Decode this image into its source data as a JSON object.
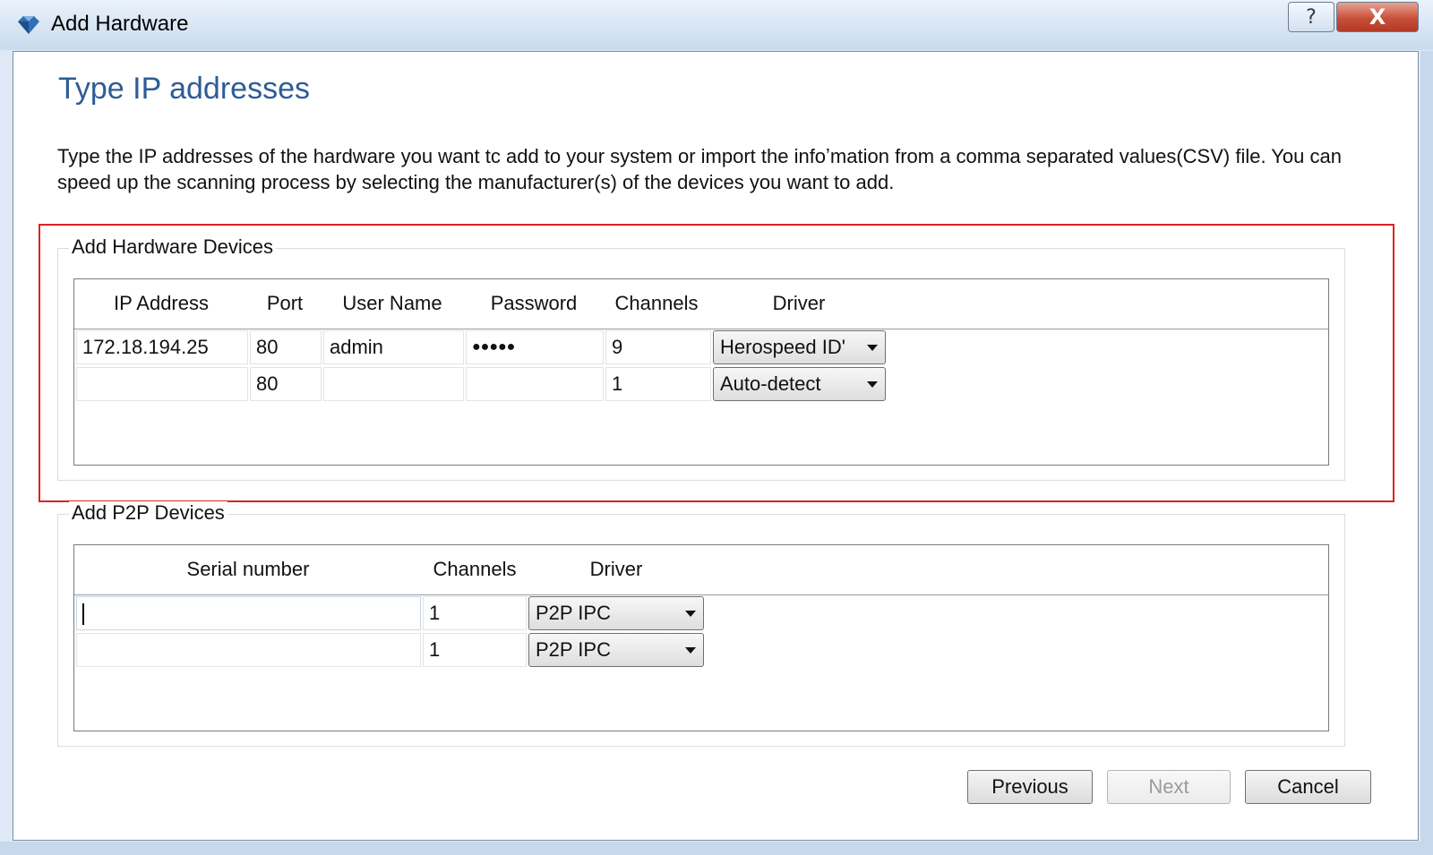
{
  "window": {
    "title": "Add Hardware",
    "help_label": "?",
    "close_label": "X"
  },
  "page": {
    "heading": "Type IP addresses",
    "description": "Type the IP addresses of the hardware you want tc add to your system or import the infoʼmation from a comma separated values(CSV) file. You can speed up the scanning process by selecting the manufacturer(s) of the devices you want to add."
  },
  "hardware_group": {
    "legend": "Add Hardware Devices",
    "headers": {
      "ip": "IP Address",
      "port": "Port",
      "user": "User Name",
      "password": "Password",
      "channels": "Channels",
      "driver": "Driver"
    },
    "rows": [
      {
        "ip": "172.18.194.25",
        "port": "80",
        "user": "admin",
        "password": "●●●●●",
        "channels": "9",
        "driver": "Herospeed ID'"
      },
      {
        "ip": "",
        "port": "80",
        "user": "",
        "password": "",
        "channels": "1",
        "driver": "Auto-detect"
      }
    ]
  },
  "p2p_group": {
    "legend": "Add P2P Devices",
    "headers": {
      "serial": "Serial number",
      "channels": "Channels",
      "driver": "Driver"
    },
    "rows": [
      {
        "serial": "",
        "channels": "1",
        "driver": "P2P IPC"
      },
      {
        "serial": "",
        "channels": "1",
        "driver": "P2P IPC"
      }
    ]
  },
  "buttons": {
    "previous": "Previous",
    "next": "Next",
    "cancel": "Cancel"
  },
  "colors": {
    "title_blue": "#2e5c96",
    "highlight_red": "#e02020",
    "close_red": "#c8503a"
  }
}
